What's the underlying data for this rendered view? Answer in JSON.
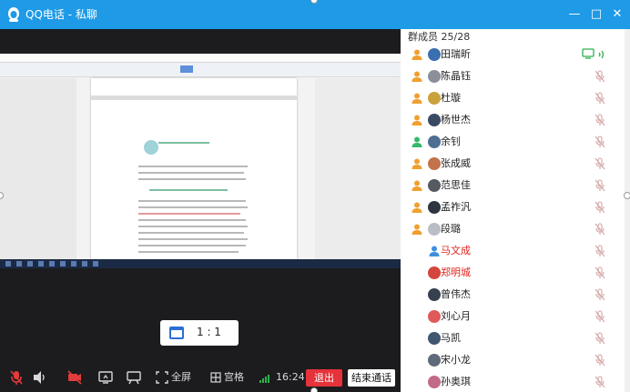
{
  "window": {
    "title": "QQ电话 - 私聊",
    "minimize_label": "—",
    "restore_label": "□",
    "close_label": "✕"
  },
  "video": {
    "ratio_label": "1 : 1"
  },
  "controls": {
    "fullscreen_label": "全屏",
    "grid_label": "宫格",
    "time": "16:24",
    "exit_label": "退出",
    "end_label": "结束通话"
  },
  "members": {
    "header": "群成员 25/28",
    "items": [
      {
        "name": "田瑞昕",
        "role": "orange",
        "avatar": "#3a6fb0",
        "highlight": false,
        "speaking": true
      },
      {
        "name": "陈晶钰",
        "role": "orange",
        "avatar": "#8a8f99",
        "highlight": false,
        "speaking": false
      },
      {
        "name": "杜璇",
        "role": "orange",
        "avatar": "#c9a23d",
        "highlight": false,
        "speaking": false
      },
      {
        "name": "杨世杰",
        "role": "orange",
        "avatar": "#3b4a63",
        "highlight": false,
        "speaking": false
      },
      {
        "name": "余钊",
        "role": "green",
        "avatar": "#4f6e94",
        "highlight": false,
        "speaking": false
      },
      {
        "name": "张成威",
        "role": "orange",
        "avatar": "#c4724a",
        "highlight": false,
        "speaking": false
      },
      {
        "name": "范思佳",
        "role": "orange",
        "avatar": "#555a60",
        "highlight": false,
        "speaking": false
      },
      {
        "name": "孟祚汎",
        "role": "orange",
        "avatar": "#2f3540",
        "highlight": false,
        "speaking": false
      },
      {
        "name": "段璐",
        "role": "orange",
        "avatar": "#b9bdc4",
        "highlight": false,
        "speaking": false
      },
      {
        "name": "马文成",
        "role": "blue",
        "avatar": "",
        "highlight": true,
        "speaking": false
      },
      {
        "name": "郑明城",
        "role": "none",
        "avatar": "#d4463b",
        "highlight": true,
        "speaking": false
      },
      {
        "name": "曾伟杰",
        "role": "none",
        "avatar": "#36404f",
        "highlight": false,
        "speaking": false
      },
      {
        "name": "刘心月",
        "role": "none",
        "avatar": "#e05a5a",
        "highlight": false,
        "speaking": false
      },
      {
        "name": "马凯",
        "role": "none",
        "avatar": "#41566f",
        "highlight": false,
        "speaking": false
      },
      {
        "name": "宋小龙",
        "role": "none",
        "avatar": "#5f6b7a",
        "highlight": false,
        "speaking": false
      },
      {
        "name": "孙奥琪",
        "role": "none",
        "avatar": "#c26a8a",
        "highlight": false,
        "speaking": false
      }
    ]
  },
  "colors": {
    "titlebar": "#1e9ae6",
    "video_bg": "#1c1c1e",
    "exit": "#e6323a",
    "highlight_name": "#e0261e",
    "speaking": "#2bb24c",
    "muted": "#d4a4a4"
  }
}
